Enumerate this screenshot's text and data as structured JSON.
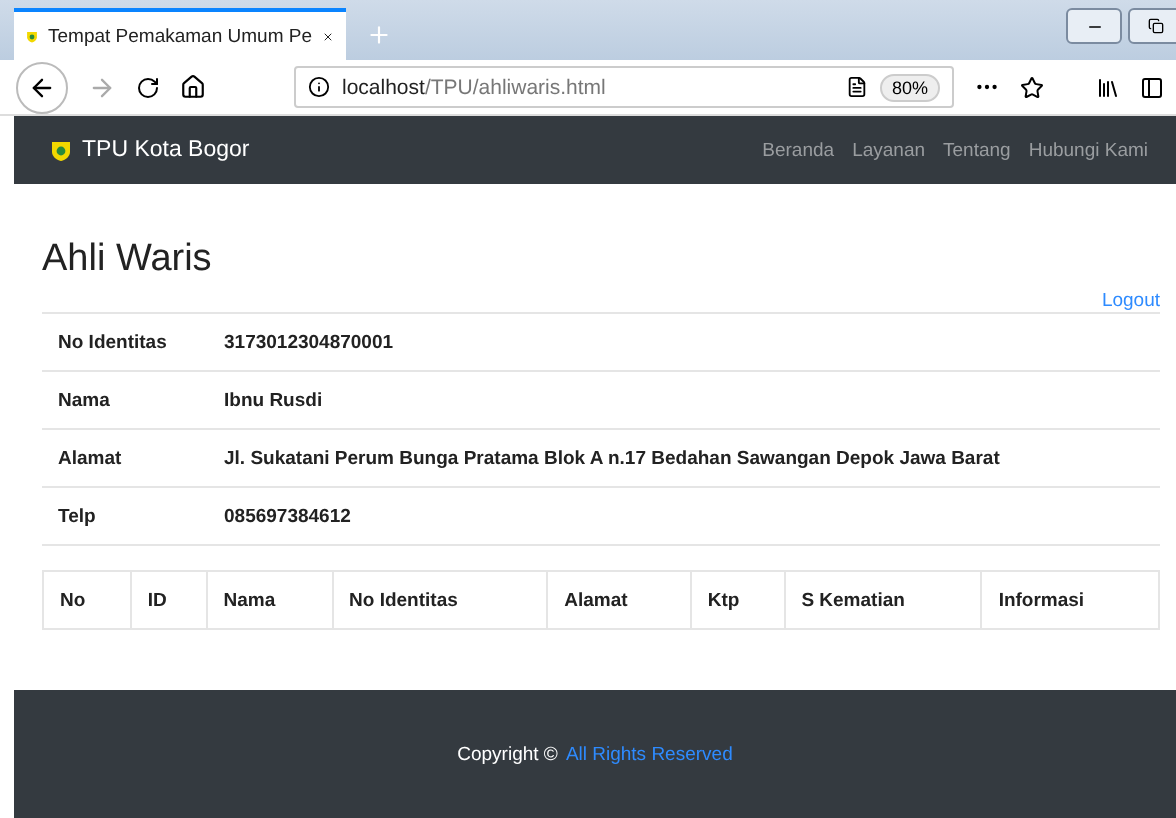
{
  "browser": {
    "tab": {
      "title": "Tempat Pemakaman Umum Pe",
      "selected": true
    },
    "url": {
      "host": "localhost",
      "path": "/TPU/ahliwaris.html"
    },
    "zoom": "80%"
  },
  "navbar": {
    "brand": "TPU Kota Bogor",
    "links": [
      "Beranda",
      "Layanan",
      "Tentang",
      "Hubungi Kami"
    ]
  },
  "heading": "Ahli Waris",
  "logout": "Logout",
  "details": [
    {
      "label": "No Identitas",
      "value": "3173012304870001"
    },
    {
      "label": "Nama",
      "value": "Ibnu Rusdi"
    },
    {
      "label": "Alamat",
      "value": "Jl. Sukatani Perum Bunga Pratama Blok A n.17 Bedahan Sawangan Depok Jawa Barat"
    },
    {
      "label": "Telp",
      "value": "085697384612"
    }
  ],
  "table": {
    "columns": [
      "No",
      "ID",
      "Nama",
      "No Identitas",
      "Alamat",
      "Ktp",
      "S Kematian",
      "Informasi"
    ]
  },
  "footer": {
    "text": "Copyright ©",
    "link": "All Rights Reserved"
  }
}
